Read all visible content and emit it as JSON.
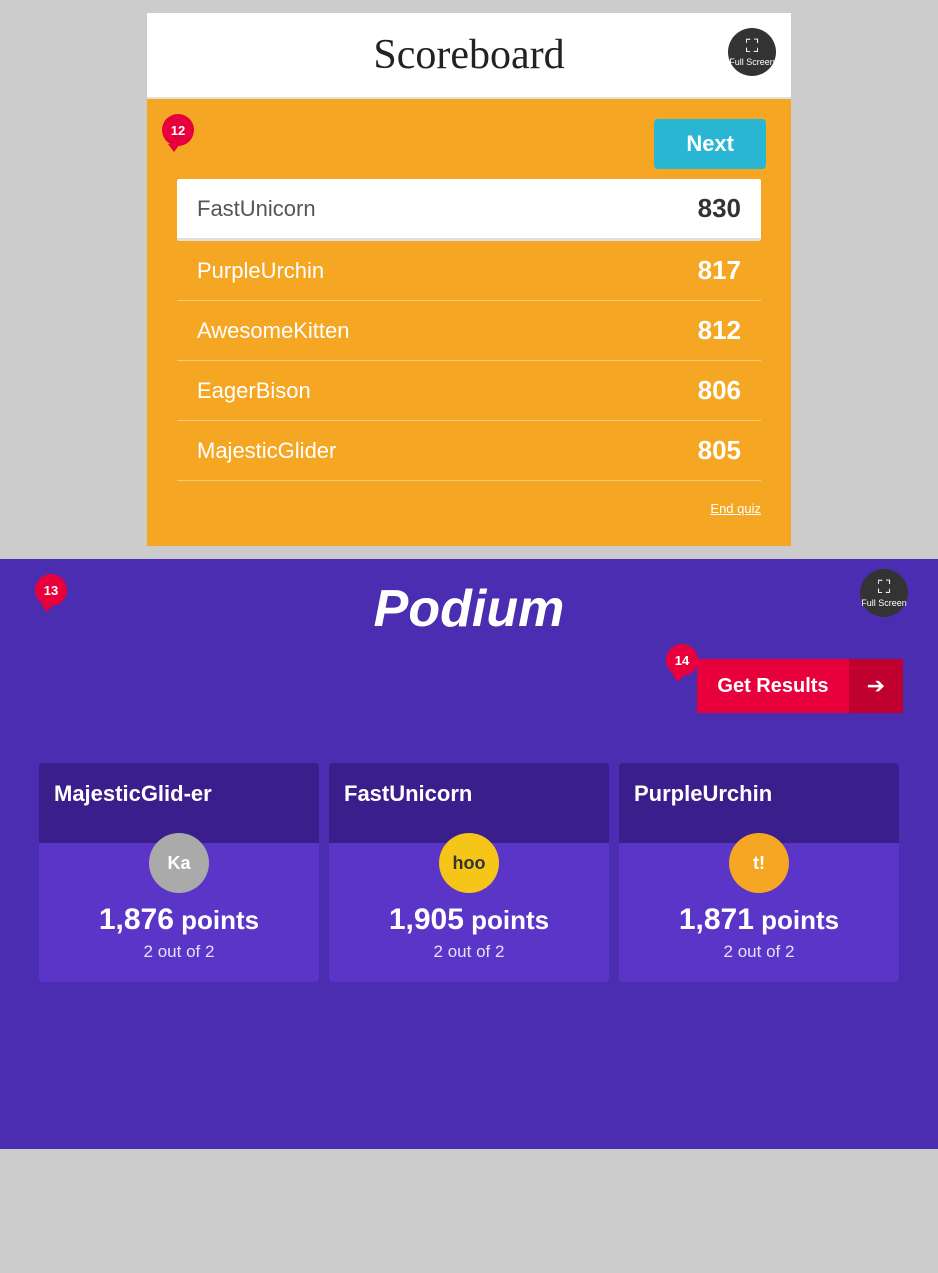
{
  "scoreboard": {
    "title": "Scoreboard",
    "fullscreen_label": "Full Screen",
    "next_label": "Next",
    "badge_number": "12",
    "end_quiz_label": "End quiz",
    "rows": [
      {
        "name": "FastUnicorn",
        "score": "830",
        "first": true
      },
      {
        "name": "PurpleUrchin",
        "score": "817",
        "first": false
      },
      {
        "name": "AwesomeKitten",
        "score": "812",
        "first": false
      },
      {
        "name": "EagerBison",
        "score": "806",
        "first": false
      },
      {
        "name": "MajesticGlider",
        "score": "805",
        "first": false
      }
    ]
  },
  "podium": {
    "title": "Podium",
    "fullscreen_label": "Full Screen",
    "badge_13": "13",
    "badge_14": "14",
    "get_results_label": "Get Results",
    "cards": [
      {
        "name": "MajesticGlider",
        "avatar_label": "Ka",
        "avatar_class": "avatar-ka",
        "points": "1,876",
        "points_label": "points",
        "out_of": "2 out of 2"
      },
      {
        "name": "FastUnicorn",
        "avatar_label": "hoo",
        "avatar_class": "avatar-hoo",
        "points": "1,905",
        "points_label": "points",
        "out_of": "2 out of 2"
      },
      {
        "name": "PurpleUrchin",
        "avatar_label": "t!",
        "avatar_class": "avatar-t",
        "points": "1,871",
        "points_label": "points",
        "out_of": "2 out of 2"
      }
    ]
  }
}
